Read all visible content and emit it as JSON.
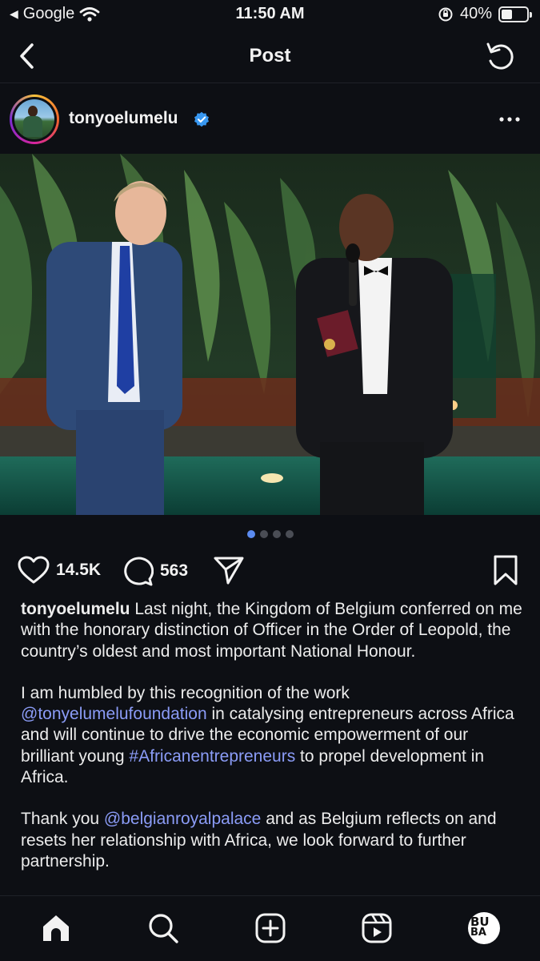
{
  "status_bar": {
    "back_app": "Google",
    "time": "11:50 AM",
    "battery": "40%",
    "battery_level": 0.4
  },
  "nav": {
    "title": "Post"
  },
  "post": {
    "username": "tonyoelumelu",
    "carousel": {
      "count": 4,
      "active_index": 0
    },
    "likes": "14.5K",
    "comments": "563",
    "caption": {
      "author": "tonyoelumelu",
      "p1_text": " Last night, the Kingdom of Belgium conferred on me with the honorary distinction of Officer in the Order of Leopold, the country’s oldest and most important National Honour.",
      "p2_a": "I am humbled by this recognition of the work ",
      "p2_mention": "@tonyelumelufoundation",
      "p2_b": " in catalysing entrepreneurs across Africa and will continue to drive the economic empowerment of our brilliant young ",
      "p2_hashtag": "#Africanentrepreneurs",
      "p2_c": " to propel development in Africa.",
      "p3_a": "Thank you ",
      "p3_mention": "@belgianroyalpalace",
      "p3_b": " and as Belgium reflects on and resets her relationship with Africa, we look forward to further partnership."
    }
  },
  "tabbar": {
    "profile_text_top": "BU",
    "profile_text_bottom": "BA"
  },
  "colors": {
    "background": "#0d0f14",
    "link": "#8b9cf7",
    "verified": "#3897f0",
    "active_dot": "#5b8bf0"
  }
}
